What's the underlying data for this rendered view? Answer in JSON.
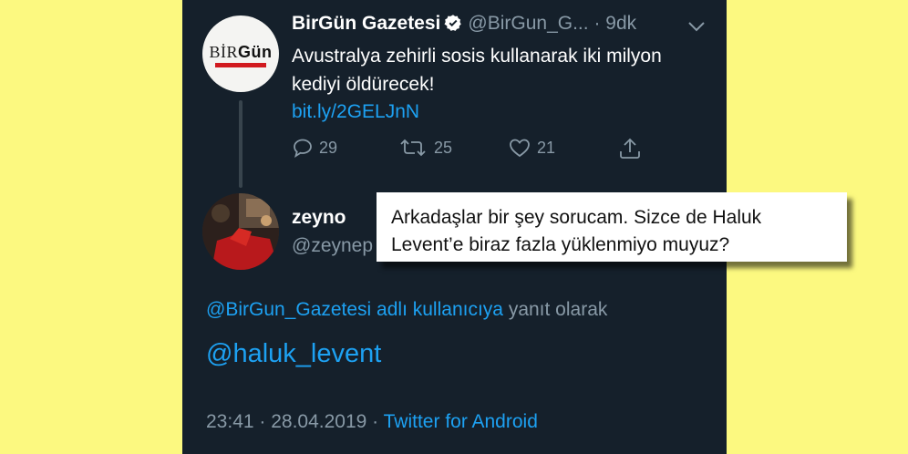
{
  "original_tweet": {
    "display_name": "BirGün Gazetesi",
    "handle": "@BirGun_G...",
    "time_ago": "· 9dk",
    "text": "Avustralya zehirli sosis kullanarak iki milyon kediyi öldürecek!",
    "link": "bit.ly/2GELJnN",
    "replies": "29",
    "retweets": "25",
    "likes": "21",
    "avatar_logo": {
      "part1": "BİR",
      "part2": "Gün"
    },
    "verified": true,
    "icons": [
      "verified-badge-icon",
      "chevron-down-icon",
      "reply-icon",
      "retweet-icon",
      "like-icon",
      "share-icon"
    ]
  },
  "reply_tweet": {
    "display_name": "zeyno",
    "handle": "@zeynep",
    "reply_context_user": "@BirGun_Gazetesi adlı kullanıcıya",
    "reply_context_suffix": " yanıt olarak",
    "mention": "@haluk_levent",
    "time": "23:41",
    "separator": " · ",
    "date": "28.04.2019",
    "client": "Twitter for Android"
  },
  "overlay": {
    "line1": "Arkadaşlar bir şey sorucam. Sizce de Haluk",
    "line2": "Levent’e biraz fazla yüklenmiyo muyuz?"
  },
  "colors": {
    "background": "#fcf980",
    "panel": "#15202b",
    "accent": "#1da1f2",
    "muted": "#8899a6",
    "brand_red": "#d11a1f"
  }
}
